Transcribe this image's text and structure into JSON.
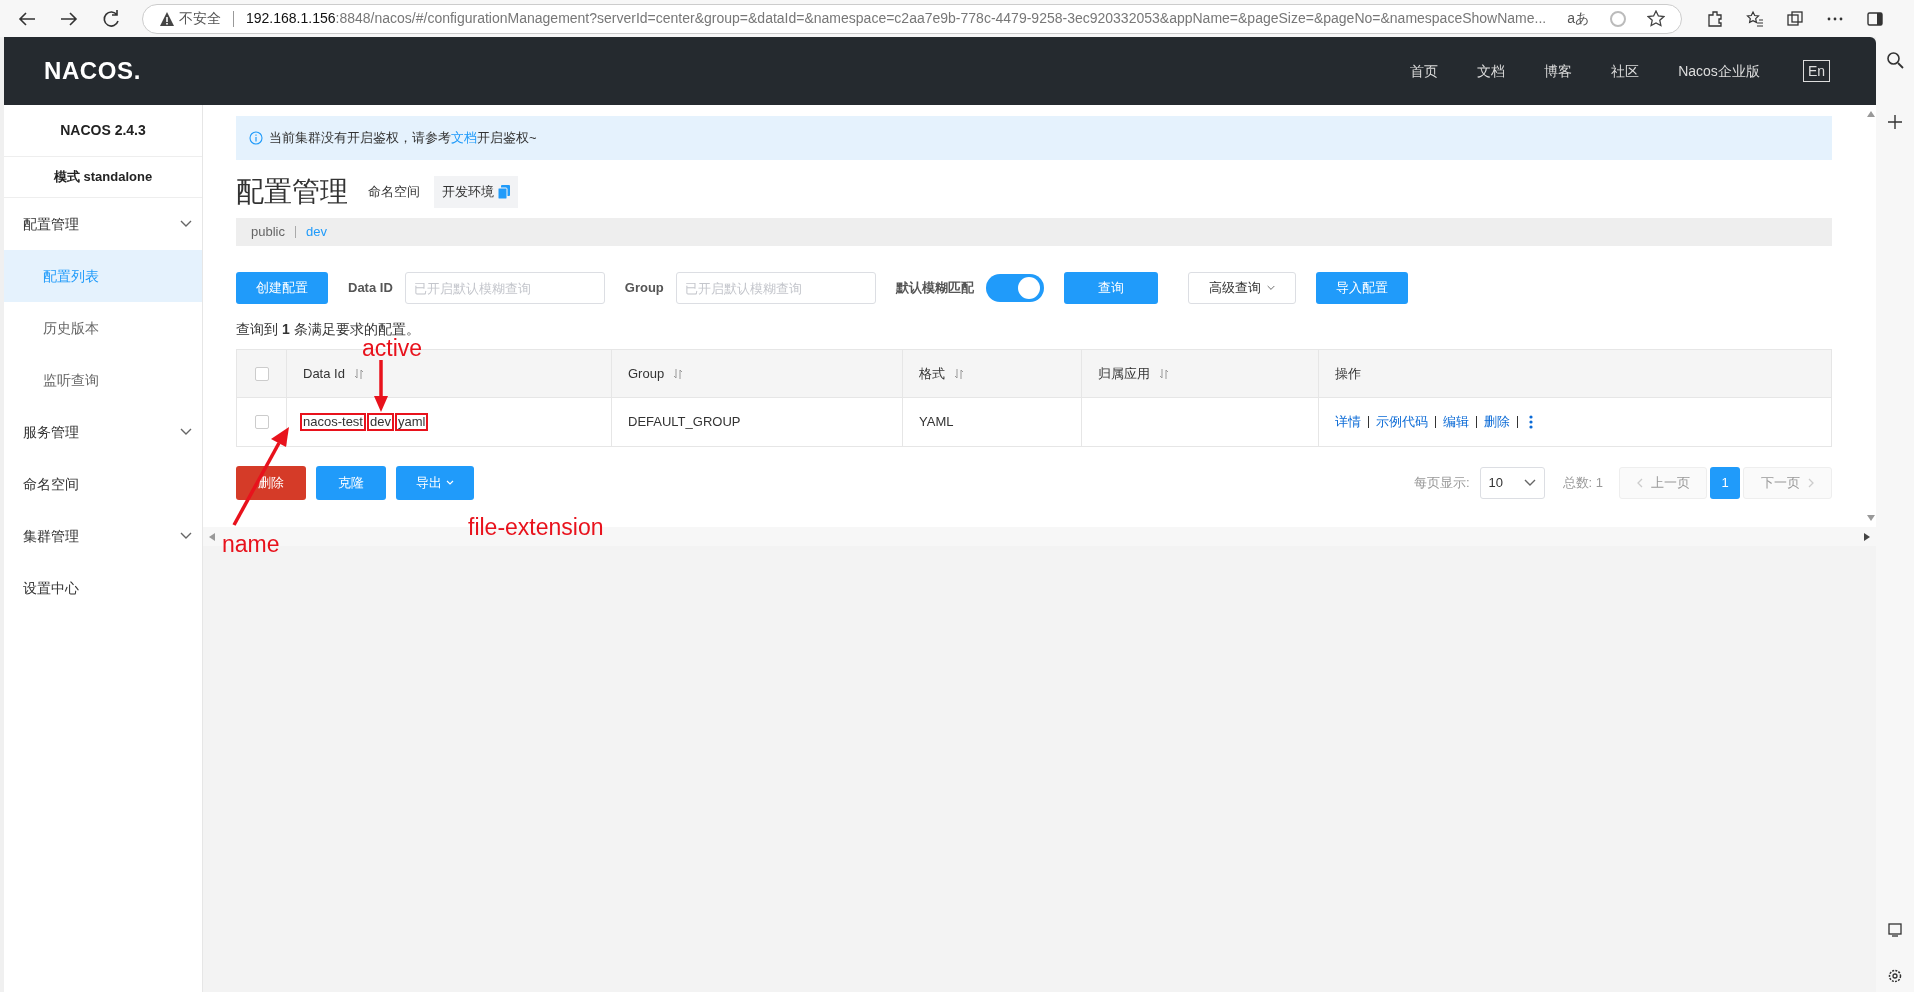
{
  "browser": {
    "security": "不安全",
    "read_aloud": "aあ",
    "url_host": "192.168.1.156",
    "url_rest": ":8848/nacos/#/configurationManagement?serverId=center&group=&dataId=&namespace=c2aa7e9b-778c-4479-9258-3ec920332053&appName=&pageSize=&pageNo=&namespaceShowName..."
  },
  "header": {
    "logo": "NACOS.",
    "nav": [
      "首页",
      "文档",
      "博客",
      "社区",
      "Nacos企业版"
    ],
    "language": "En"
  },
  "sidebar": {
    "version": "NACOS 2.4.3",
    "mode": "模式 standalone",
    "items": [
      {
        "label": "配置管理",
        "kind": "group",
        "children": [
          {
            "label": "配置列表",
            "selected": true
          },
          {
            "label": "历史版本",
            "selected": false
          },
          {
            "label": "监听查询",
            "selected": false
          }
        ]
      },
      {
        "label": "服务管理",
        "kind": "group"
      },
      {
        "label": "命名空间",
        "kind": "link"
      },
      {
        "label": "集群管理",
        "kind": "group"
      },
      {
        "label": "设置中心",
        "kind": "link"
      }
    ]
  },
  "notice": {
    "before": "当前集群没有开启鉴权，请参考",
    "link": "文档",
    "after": "开启鉴权~"
  },
  "title": "配置管理",
  "namespace_label": "命名空间",
  "namespace_current": "开发环境",
  "namespaces": [
    {
      "label": "public",
      "selected": false
    },
    {
      "label": "dev",
      "selected": true
    }
  ],
  "toolbar": {
    "create": "创建配置",
    "fields": [
      {
        "label": "Data ID",
        "placeholder": "已开启默认模糊查询"
      },
      {
        "label": "Group",
        "placeholder": "已开启默认模糊查询"
      }
    ],
    "toggle": {
      "label": "默认模糊匹配",
      "on": true
    },
    "query": "查询",
    "advanced": "高级查询",
    "import": "导入配置"
  },
  "result": "查询到 **1** 条满足要求的配置。",
  "table": {
    "all_checked": false,
    "columns": [
      {
        "label": "Data Id",
        "sortable": true
      },
      {
        "label": "Group",
        "sortable": true
      },
      {
        "label": "格式",
        "sortable": true
      },
      {
        "label": "归属应用",
        "sortable": true
      },
      {
        "label": "操作",
        "sortable": false
      }
    ],
    "rows": [
      {
        "checked": false,
        "data_id_parts": [
          "nacos-test",
          "dev",
          "yaml"
        ],
        "group": "DEFAULT_GROUP",
        "format": "YAML",
        "actions": [
          "详情",
          "示例代码",
          "编辑",
          "删除"
        ]
      }
    ]
  },
  "bulk_buttons": [
    {
      "label": "删除",
      "kind": "danger"
    },
    {
      "label": "克隆",
      "kind": "primary"
    },
    {
      "label": "导出",
      "kind": "dropdown"
    }
  ],
  "pagination": {
    "page_size_label": "每页显示:",
    "page_size": "10",
    "total": "总数: 1",
    "prev": "上一页",
    "pages": [
      {
        "label": "1",
        "selected": true
      }
    ],
    "next": "下一页"
  },
  "annotations": [
    {
      "label": "active",
      "kind": "down"
    },
    {
      "label": "name",
      "kind": "up"
    },
    {
      "label": "file-extension",
      "kind": "none"
    }
  ]
}
